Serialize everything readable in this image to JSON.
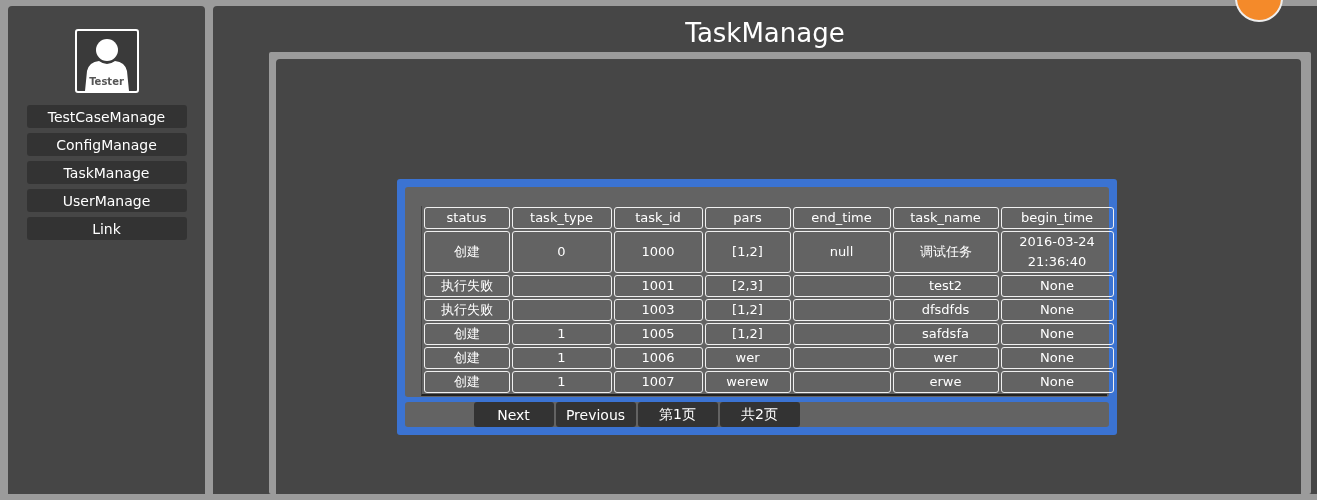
{
  "sidebar": {
    "avatar_label": "Tester",
    "items": [
      {
        "label": "TestCaseManage"
      },
      {
        "label": "ConfigManage"
      },
      {
        "label": "TaskManage"
      },
      {
        "label": "UserManage"
      },
      {
        "label": "Link"
      }
    ]
  },
  "title": "TaskManage",
  "table": {
    "columns": [
      "status",
      "task_type",
      "task_id",
      "pars",
      "end_time",
      "task_name",
      "begin_time"
    ],
    "rows": [
      [
        "创建",
        "0",
        "1000",
        "[1,2]",
        "null",
        "调试任务",
        "2016-03-24 21:36:40"
      ],
      [
        "执行失败",
        "",
        "1001",
        "[2,3]",
        "",
        "test2",
        "None"
      ],
      [
        "执行失败",
        "",
        "1003",
        "[1,2]",
        "",
        "dfsdfds",
        "None"
      ],
      [
        "创建",
        "1",
        "1005",
        "[1,2]",
        "",
        "safdsfa",
        "None"
      ],
      [
        "创建",
        "1",
        "1006",
        "wer",
        "",
        "wer",
        "None"
      ],
      [
        "创建",
        "1",
        "1007",
        "werew",
        "",
        "erwe",
        "None"
      ]
    ]
  },
  "pager": [
    "Next",
    "Previous",
    "第1页",
    "共2页"
  ]
}
